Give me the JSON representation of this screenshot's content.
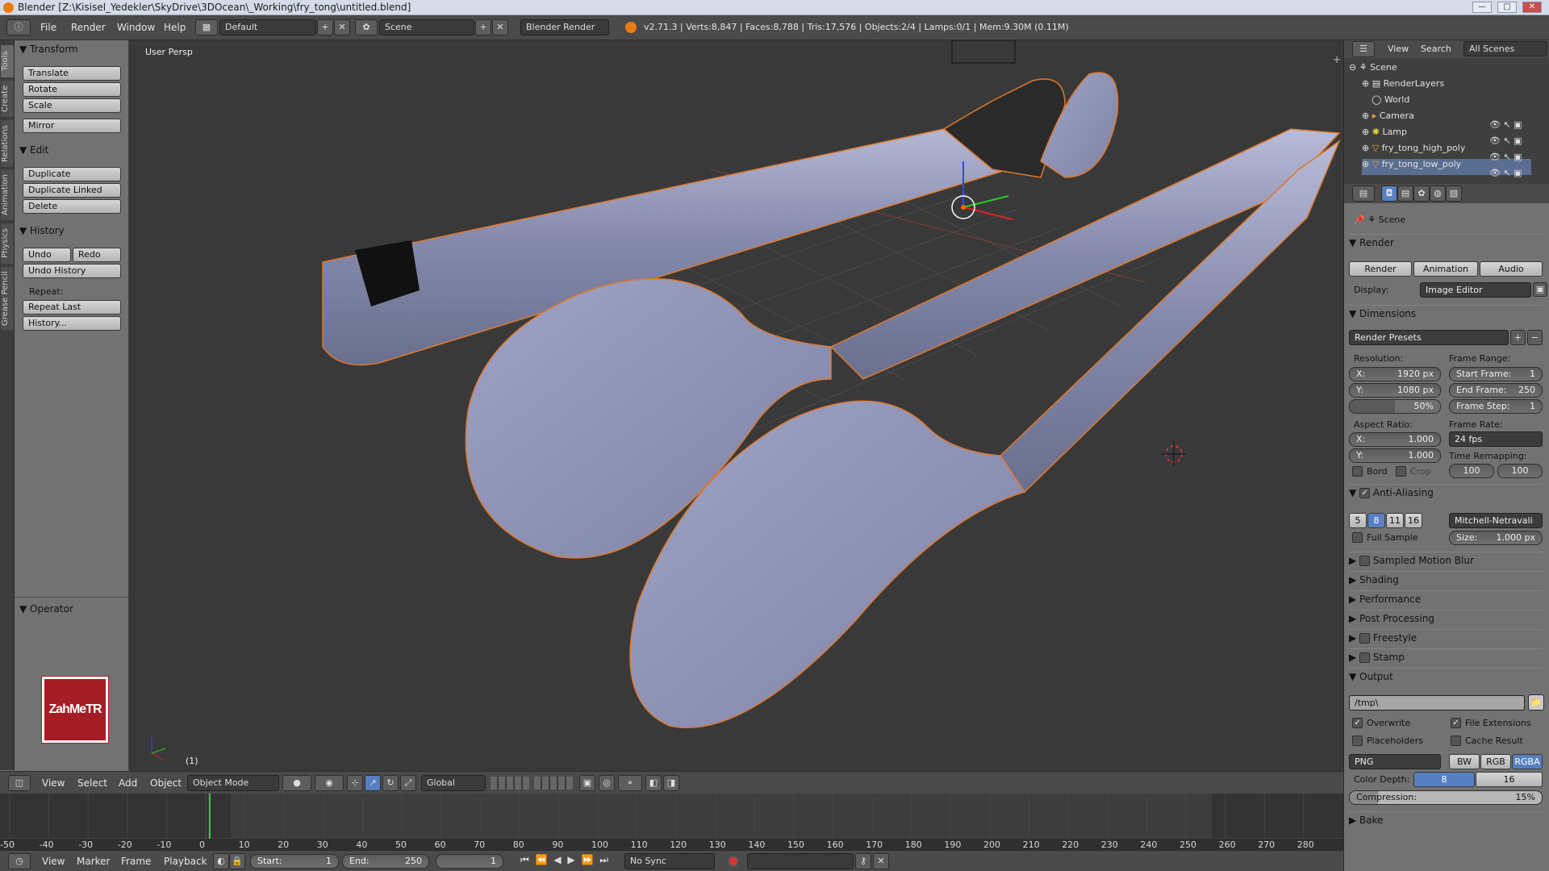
{
  "window": {
    "title": "Blender [Z:\\Kisisel_Yedekler\\SkyDrive\\3DOcean\\_Working\\fry_tong\\untitled.blend]",
    "btn_min": "—",
    "btn_max": "□",
    "btn_close": "✕"
  },
  "topbar": {
    "menus": [
      "File",
      "Render",
      "Window",
      "Help"
    ],
    "layout": "Default",
    "scene": "Scene",
    "engine": "Blender Render",
    "stats": "v2.71.3 | Verts:8,847 | Faces:8,788 | Tris:17,576 | Objects:2/4 | Lamps:0/1 | Mem:9.30M (0.11M)"
  },
  "toolstrip_tabs": [
    "Tools",
    "Create",
    "Relations",
    "Animation",
    "Physics",
    "Grease Pencil"
  ],
  "toolshelf": {
    "transform": {
      "label": "Transform",
      "items": [
        "Translate",
        "Rotate",
        "Scale",
        "Mirror"
      ]
    },
    "edit": {
      "label": "Edit",
      "items": [
        "Duplicate",
        "Duplicate Linked",
        "Delete"
      ]
    },
    "history": {
      "label": "History",
      "undo": "Undo",
      "redo": "Redo",
      "undo_history": "Undo History",
      "repeat_label": "Repeat:",
      "repeat_last": "Repeat Last",
      "history": "History..."
    },
    "operator": "Operator",
    "logo": "ZahMeTR"
  },
  "viewport": {
    "label": "User Persp",
    "frame_indicator": "(1)"
  },
  "vp_header": {
    "menus": [
      "View",
      "Select",
      "Add",
      "Object"
    ],
    "mode": "Object Mode",
    "orientation": "Global"
  },
  "timeline": {
    "ticks": [
      "-50",
      "-40",
      "-30",
      "-20",
      "-10",
      "0",
      "10",
      "20",
      "30",
      "40",
      "50",
      "60",
      "70",
      "80",
      "90",
      "100",
      "110",
      "120",
      "130",
      "140",
      "150",
      "160",
      "170",
      "180",
      "190",
      "200",
      "210",
      "220",
      "230",
      "240",
      "250",
      "260",
      "270",
      "280"
    ],
    "current_frame": 1,
    "footer_menus": [
      "View",
      "Marker",
      "Frame",
      "Playback"
    ],
    "start": "Start:",
    "start_val": "1",
    "end": "End:",
    "end_val": "250",
    "frame_val": "1",
    "sync": "No Sync"
  },
  "outliner": {
    "menus": [
      "View",
      "Search"
    ],
    "filter": "All Scenes",
    "rows": [
      "Scene",
      "RenderLayers",
      "World",
      "Camera",
      "Lamp",
      "fry_tong_high_poly",
      "fry_tong_low_poly"
    ]
  },
  "props": {
    "context": "Scene",
    "render": {
      "label": "Render",
      "render_btn": "Render",
      "anim_btn": "Animation",
      "audio_btn": "Audio",
      "display_label": "Display:",
      "display_val": "Image Editor"
    },
    "dimensions": {
      "label": "Dimensions",
      "presets": "Render Presets",
      "resolution": "Resolution:",
      "res_x": "X:",
      "res_x_val": "1920 px",
      "res_y": "Y:",
      "res_y_val": "1080 px",
      "res_pct": "50%",
      "frame_range": "Frame Range:",
      "start_frame": "Start Frame:",
      "start_frame_val": "1",
      "end_frame": "End Frame:",
      "end_frame_val": "250",
      "frame_step": "Frame Step:",
      "frame_step_val": "1",
      "aspect": "Aspect Ratio:",
      "asp_x": "X:",
      "asp_x_val": "1.000",
      "asp_y": "Y:",
      "asp_y_val": "1.000",
      "frame_rate": "Frame Rate:",
      "fps": "24 fps",
      "time_remap": "Time Remapping:",
      "remap_old": "100",
      "remap_new": "100",
      "bord": "Bord",
      "crop": "Crop"
    },
    "aa": {
      "label": "Anti-Aliasing",
      "samples": [
        "5",
        "8",
        "11",
        "16"
      ],
      "selected": "8",
      "filter": "Mitchell-Netravali",
      "full_sample": "Full Sample",
      "size_label": "Size:",
      "size_val": "1.000 px"
    },
    "collapsed": [
      "Sampled Motion Blur",
      "Shading",
      "Performance",
      "Post Processing",
      "Freestyle",
      "Stamp"
    ],
    "output": {
      "label": "Output",
      "path": "/tmp\\",
      "overwrite": "Overwrite",
      "file_ext": "File Extensions",
      "placeholders": "Placeholders",
      "cache": "Cache Result",
      "format": "PNG",
      "bw": "BW",
      "rgb": "RGB",
      "rgba": "RGBA",
      "depth_label": "Color Depth:",
      "depth_8": "8",
      "depth_16": "16",
      "compression": "Compression:",
      "compression_val": "15%"
    },
    "bake": "Bake"
  }
}
